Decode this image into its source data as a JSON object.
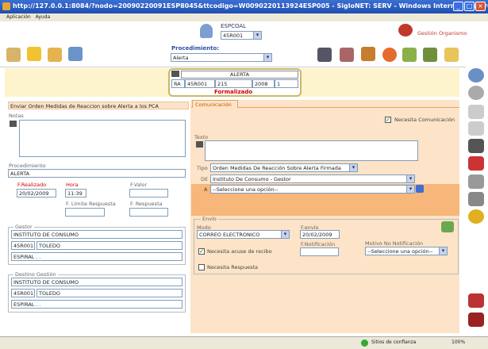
{
  "window": {
    "title": "http://127.0.0.1:8084/?nodo=20090220091ESP8045&ttcodigo=W0090220113924ESP005 - SigloNET: SERV - Windows Internet Explorer"
  },
  "menu": {
    "items": [
      "Aplicación",
      "Ayuda"
    ]
  },
  "header": {
    "user_label": "ESPCOAL",
    "user_select": "45R001",
    "org_label": "Gestión Organismo"
  },
  "procedimiento": {
    "label": "Procedimiento:",
    "value": "Alerta"
  },
  "alert_box": {
    "title": "ALERTA",
    "code": "RA",
    "org": "45R001",
    "num": "215",
    "year": "2008",
    "seq": "1",
    "status": "Formalizado"
  },
  "left": {
    "banner": "Enviar Orden Medidas de Reaccion sobre Alerta a los PCA",
    "notas_label": "Notas",
    "procedimiento_label": "Procedimiento",
    "procedimiento_value": "ALERTA",
    "f_realizado_label": "F.Realizado",
    "f_realizado": "20/02/2009",
    "hora_label": "Hora",
    "hora": "11:39",
    "f_valor_label": "F.Valor",
    "f_limite_label": "F. Límite Respuesta",
    "f_respuesta_label": "F. Respuesta",
    "gestor_label": "Gestor",
    "gestor_name": "INSTITUTO DE CONSUMO",
    "gestor_code": "45R001",
    "gestor_city": "TOLEDO",
    "gestor_addr": "ESPIRAL . .",
    "destino_label": "Destino Gestión",
    "destino_name": "INSTITUTO DE CONSUMO",
    "destino_code": "45R001",
    "destino_city": "TOLEDO",
    "destino_addr": "ESPIRAL . ."
  },
  "right": {
    "tab": "Comunicación",
    "necesita_com": "Necesita Comunicación",
    "texto_label": "Texto",
    "tipo_label": "Tipo",
    "tipo_value": "Orden Medidas De Reacción Sobre Alerta Firmada",
    "de_label": "DE",
    "de_value": "Instituto De Consumo - Gestor",
    "a_label": "A",
    "a_value": "--Seleccione una opción--",
    "envio_label": "Envío",
    "modo_label": "Modo",
    "modo_value": "CORREO ELECTRONICO",
    "fenvio_label": "F.envío",
    "fenvio_value": "20/02/2009",
    "acuse_label": "Necesita acuse de recibo",
    "fnotif_label": "F.Notificación",
    "motivo_label": "Motivo No Notificación",
    "motivo_value": "--Seleccione una opción--",
    "necesita_resp": "Necesita Respuesta"
  },
  "status": {
    "zone": "Sitios de confianza",
    "zoom": "100%"
  }
}
